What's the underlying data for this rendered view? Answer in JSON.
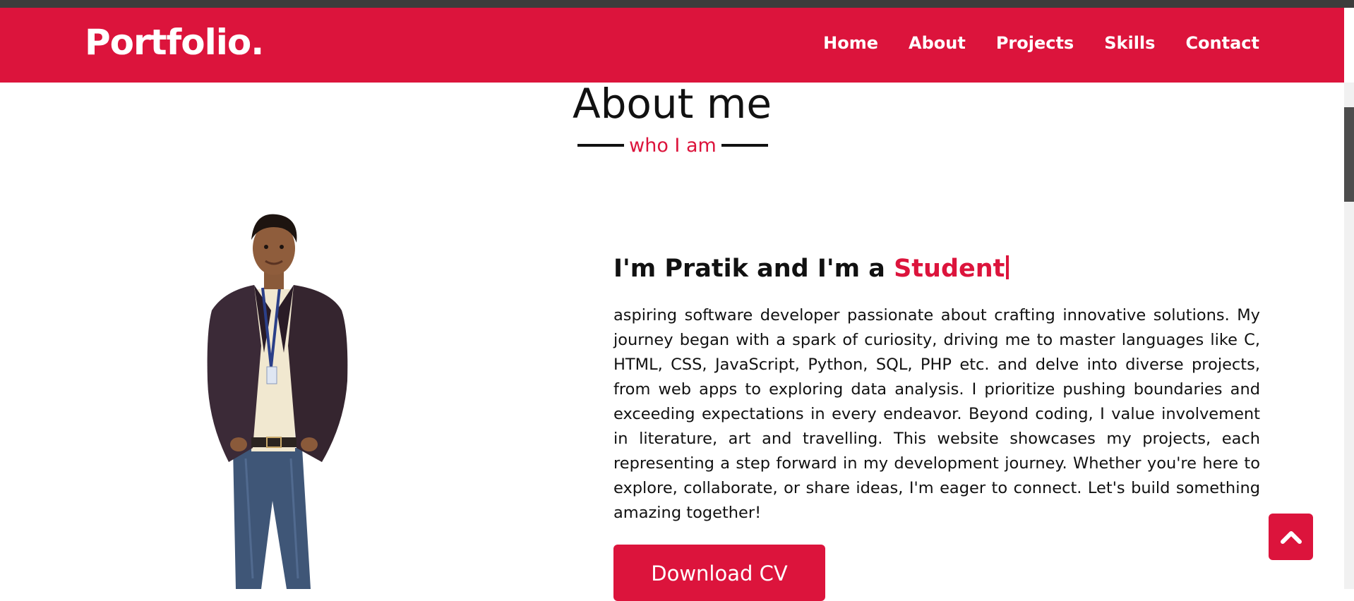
{
  "navbar": {
    "logo": "Portfolio.",
    "items": [
      {
        "label": "Home"
      },
      {
        "label": "About"
      },
      {
        "label": "Projects"
      },
      {
        "label": "Skills"
      },
      {
        "label": "Contact"
      }
    ]
  },
  "about": {
    "title": "About me",
    "subtitle": "who I am",
    "intro_prefix": "I'm Pratik and I'm a ",
    "intro_role": "Student",
    "bio": "aspiring software developer passionate about crafting innovative solutions. My journey began with a spark of curiosity, driving me to master languages like C, HTML, CSS, JavaScript, Python, SQL, PHP etc. and delve into diverse projects, from web apps to exploring data analysis. I prioritize pushing boundaries and exceeding expectations in every endeavor. Beyond coding, I value involvement in literature, art and travelling. This website showcases my projects, each representing a step forward in my development journey. Whether you're here to explore, collaborate, or share ideas, I'm eager to connect. Let's build something amazing together!",
    "cv_button": "Download CV"
  },
  "icons": {
    "scroll_top": "chevron-up-icon",
    "photo": "person-photo"
  },
  "colors": {
    "accent": "#dc143c",
    "text": "#111111",
    "background": "#ffffff"
  }
}
